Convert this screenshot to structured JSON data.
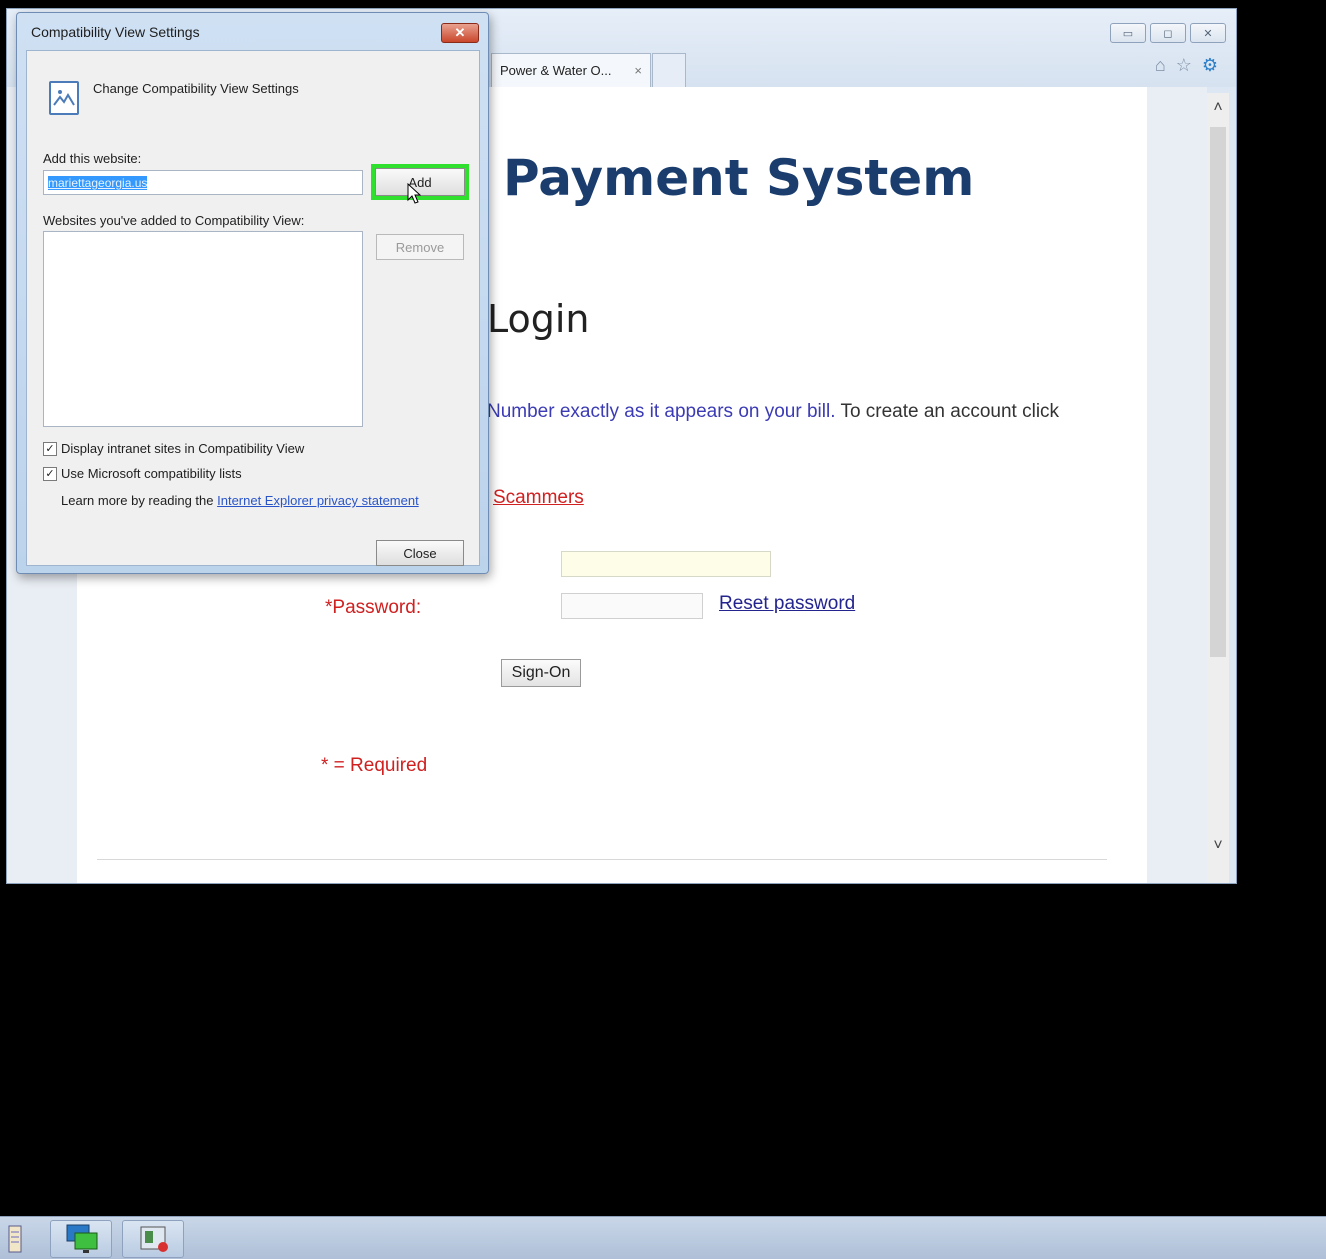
{
  "browser": {
    "tab_title": "Power & Water O...",
    "tab_close": "×",
    "window_buttons": [
      "minimize-icon",
      "restore-icon",
      "close-icon"
    ],
    "toolbar_icons": [
      "home-icon",
      "favorites-star-icon",
      "settings-gear-icon"
    ]
  },
  "page": {
    "heading": "Payment System",
    "login_heading": "Login",
    "instruction_blue": "Number exactly as it appears on your bill.",
    "instruction_dark": "To create an account click",
    "scammers_link": "Scammers",
    "password_label": "*Password:",
    "reset_password_link": "Reset password",
    "signon_button": "Sign-On",
    "required_note": "* = Required"
  },
  "dialog": {
    "title": "Compatibility View Settings",
    "close_glyph": "✕",
    "subtitle": "Change Compatibility View Settings",
    "add_label": "Add this website:",
    "website_value": "mariettageorgia.us",
    "add_button": "Add",
    "list_label": "Websites you've added to Compatibility View:",
    "websites": [],
    "remove_button": "Remove",
    "checkbox_intranet": "Display intranet sites in Compatibility View",
    "checkbox_intranet_checked": true,
    "checkbox_ms_lists": "Use Microsoft compatibility lists",
    "checkbox_ms_lists_checked": true,
    "learn_more_text": "Learn more by reading the",
    "privacy_link": "Internet Explorer privacy statement",
    "close_button": "Close"
  },
  "taskbar": {
    "items": [
      "notepad-icon",
      "remote-desktop-icon",
      "screen-recorder-icon"
    ]
  },
  "colors": {
    "heading": "#1a3d6d",
    "red_text": "#d02020",
    "link_blue": "#24248f",
    "highlight_green": "#2fe02f",
    "selection_blue": "#3399ff"
  }
}
